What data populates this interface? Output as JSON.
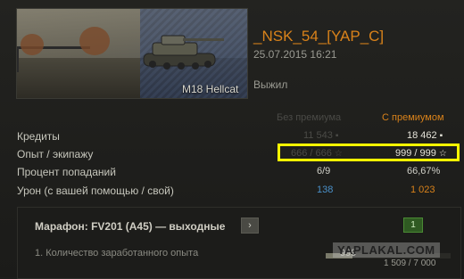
{
  "header": {
    "tank_name": "M18 Hellcat",
    "player": "_NSK_54_[YAP_C]",
    "date": "25.07.2015 16:21",
    "status": "Выжил"
  },
  "columns": {
    "no_premium": "Без премиума",
    "premium": "С премиумом"
  },
  "rows": [
    {
      "label": "Кредиты",
      "no_premium": "11 543",
      "premium": "18 462",
      "icon": "credits-icon"
    },
    {
      "label": "Опыт / экипажу",
      "no_premium": "666 / 666",
      "premium": "999 / 999",
      "icon": "xp-star-icon"
    },
    {
      "label": "Процент попаданий",
      "no_premium": "6/9",
      "premium": "66,67%"
    },
    {
      "label": "Урон (с вашей помощью / свой)",
      "no_premium": "138",
      "premium": "1 023"
    }
  ],
  "panel": {
    "title": "Марафон: FV201 (A45) — выходные",
    "chevron": "›",
    "badge": "1",
    "task": "1. Количество заработанного опыта",
    "progress_value": "999",
    "progress_total": "1 509 / 7 000",
    "progress_fraction": 0.216
  },
  "watermark": "YAPLAKAL.COM",
  "colors": {
    "accent": "#d9821a",
    "highlight": "#ffff00",
    "blue_value": "#4a90c8"
  }
}
